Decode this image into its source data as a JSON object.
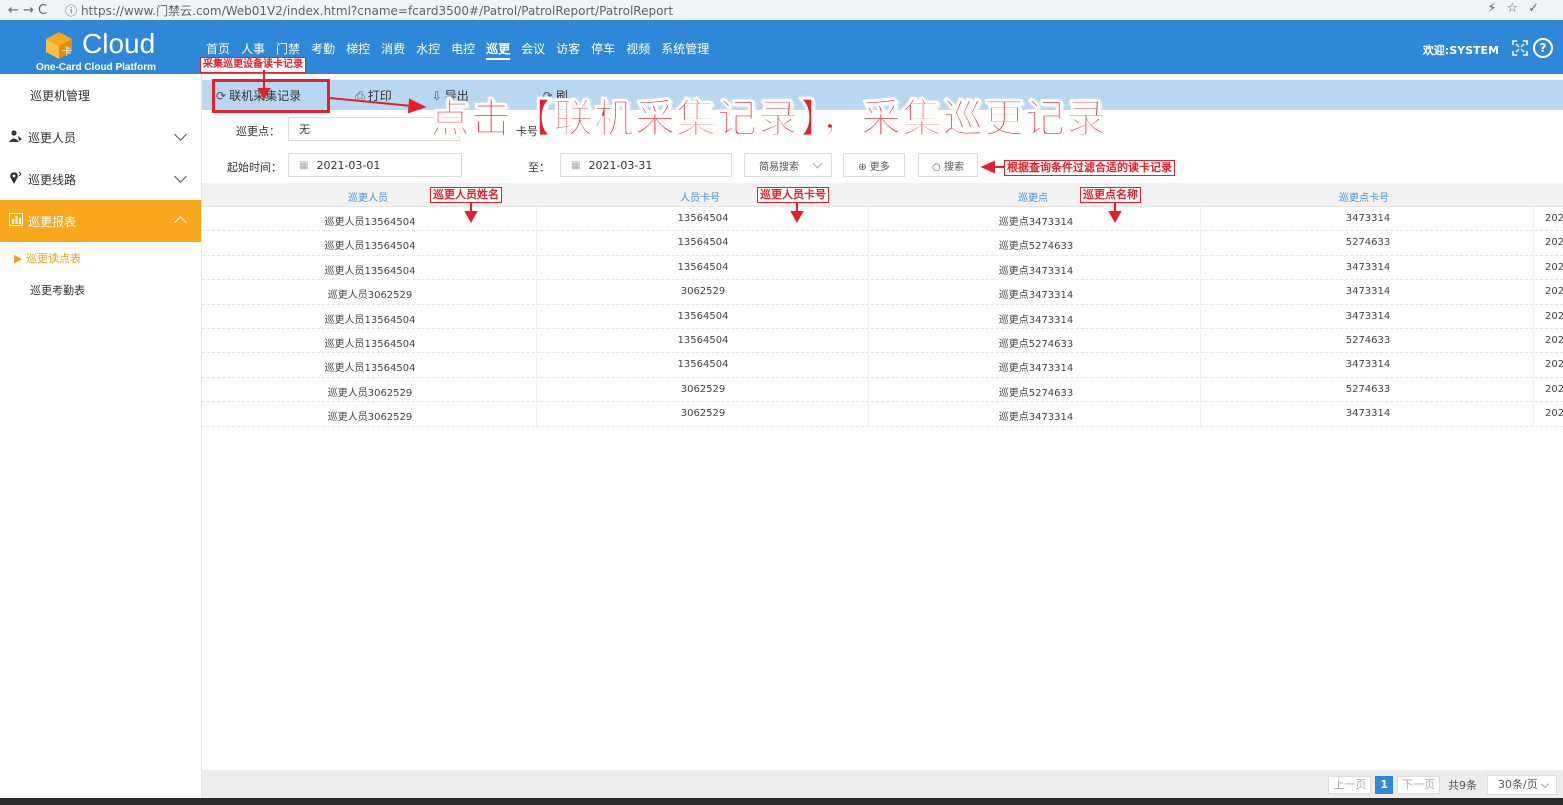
{
  "browser": {
    "nav_glyphs": "←  →  C",
    "url": "ⓘ  https://www.门禁云.com/Web01V2/index.html?cname=fcard3500#/Patrol/PatrolReport/PatrolReport",
    "right_glyphs": "⚡☆✓"
  },
  "header": {
    "logo_word": "Cloud",
    "logo_sub": "One-Card Cloud Platform",
    "nav": [
      "首页",
      "人事",
      "门禁",
      "考勤",
      "梯控",
      "消费",
      "水控",
      "电控",
      "巡更",
      "会议",
      "访客",
      "停车",
      "视频",
      "系统管理"
    ],
    "active_nav": "巡更",
    "welcome": "欢迎:SYSTEM",
    "help_glyph": "?"
  },
  "sidebar": {
    "top_item": "巡更机管理",
    "groups": [
      {
        "label": "巡更人员",
        "icon": "person-icon",
        "glyph": "👤"
      },
      {
        "label": "巡更线路",
        "icon": "location-pin-icon",
        "glyph": "📍"
      },
      {
        "label": "巡更报表",
        "icon": "bar-chart-icon",
        "glyph": "📊"
      }
    ],
    "sub_items": [
      {
        "label": "▶ 巡更读点表",
        "active": true
      },
      {
        "label": "巡更考勤表",
        "active": false
      }
    ]
  },
  "toolbar": {
    "collect_label": "联机采集记录",
    "collect_glyph": "⟳",
    "print_label": "打印",
    "print_glyph": "⎙",
    "export_label": "导出",
    "export_glyph": "⇩",
    "refresh_glyph": "⟳",
    "refresh_label": "刷"
  },
  "query": {
    "point_label": "巡更点：",
    "point_value": "无",
    "card_label": "卡号：",
    "start_label": "起始时间：",
    "start_value": "2021-03-01",
    "to_label": "至：",
    "end_value": "2021-03-31",
    "mode_value": "简易搜索",
    "more_label": "⊕ 更多",
    "search_label": "○ 搜索",
    "calendar_glyph": "▦"
  },
  "table": {
    "columns": [
      "巡更人员",
      "人员卡号",
      "巡更点",
      "巡更点卡号"
    ],
    "rows": [
      [
        "巡更人员13564504",
        "13564504",
        "巡更点3473314",
        "3473314",
        "202"
      ],
      [
        "巡更人员13564504",
        "13564504",
        "巡更点5274633",
        "5274633",
        "202"
      ],
      [
        "巡更人员13564504",
        "13564504",
        "巡更点3473314",
        "3473314",
        "202"
      ],
      [
        "巡更人员3062529",
        "3062529",
        "巡更点3473314",
        "3473314",
        "202"
      ],
      [
        "巡更人员13564504",
        "13564504",
        "巡更点3473314",
        "3473314",
        "202"
      ],
      [
        "巡更人员13564504",
        "13564504",
        "巡更点5274633",
        "5274633",
        "202"
      ],
      [
        "巡更人员13564504",
        "13564504",
        "巡更点3473314",
        "3473314",
        "202"
      ],
      [
        "巡更人员3062529",
        "3062529",
        "巡更点5274633",
        "5274633",
        "202"
      ],
      [
        "巡更人员3062529",
        "3062529",
        "巡更点3473314",
        "3473314",
        "202"
      ]
    ]
  },
  "pager": {
    "prev": "上一页",
    "current": "1",
    "next": "下一页",
    "total": "共9条",
    "page_size": "30条/页"
  },
  "annotations": {
    "collect_device": "采集巡更设备读卡记录",
    "callout": "点击【联机采集记录】，采集巡更记录",
    "filter_hint": "根据查询条件过滤合适的读卡记录",
    "col_name": "巡更人员姓名",
    "col_card": "巡更人员卡号",
    "col_point": "巡更点名称",
    "color": "#e5202a"
  }
}
